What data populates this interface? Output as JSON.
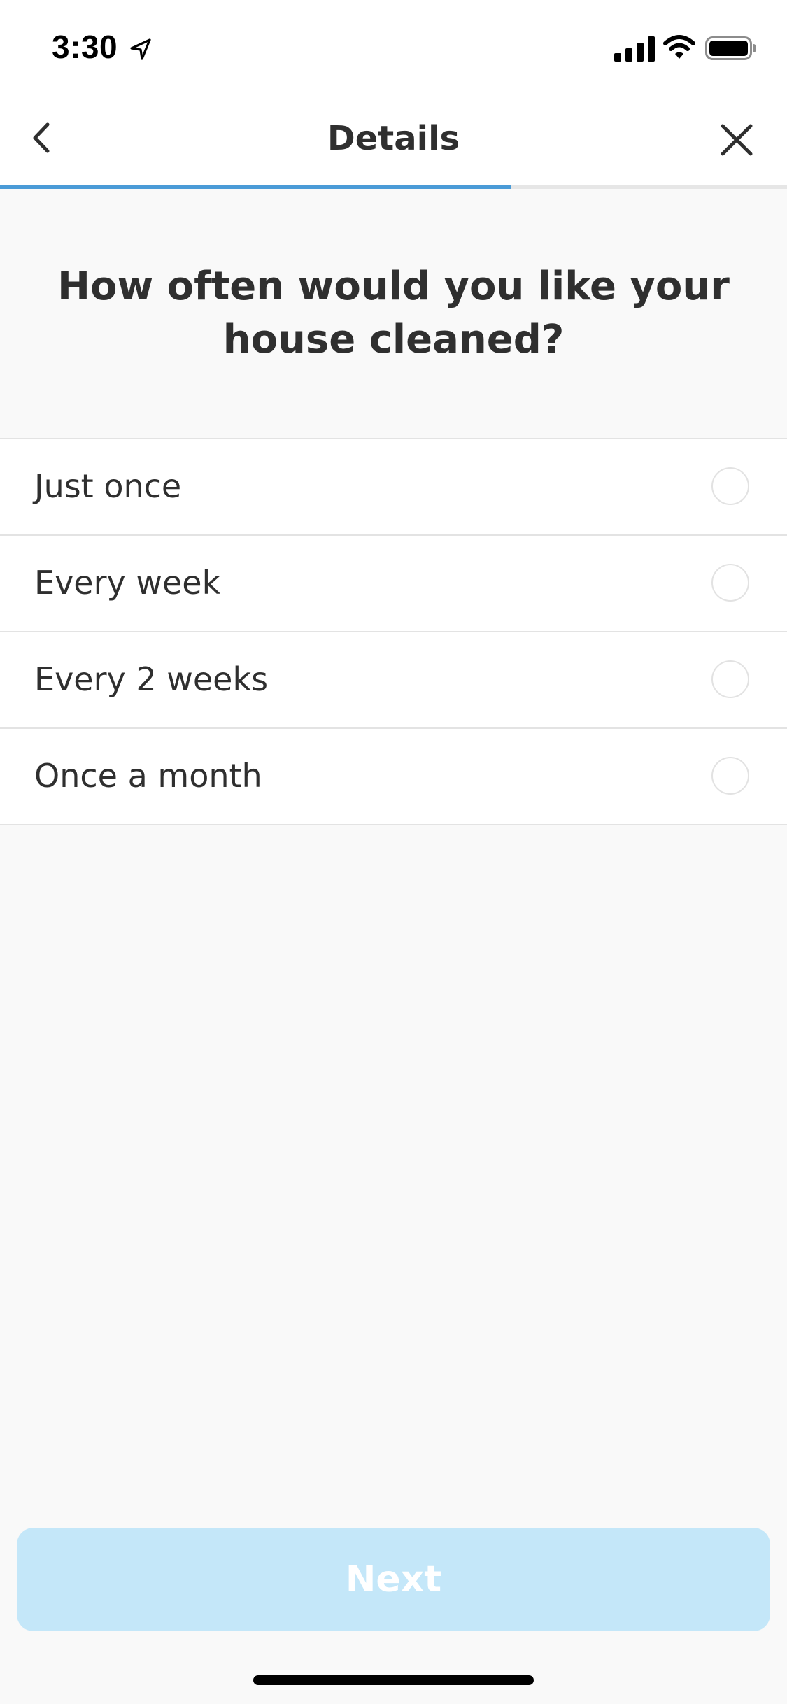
{
  "status_bar": {
    "time": "3:30",
    "icons": [
      "location-arrow-icon",
      "cellular-signal-icon",
      "wifi-icon",
      "battery-icon"
    ]
  },
  "nav": {
    "title": "Details",
    "back_icon": "chevron-left-icon",
    "close_icon": "close-icon",
    "progress_fraction": 0.65
  },
  "question": {
    "text": "How often would you like your house cleaned?"
  },
  "options": [
    {
      "label": "Just once",
      "selected": false
    },
    {
      "label": "Every week",
      "selected": false
    },
    {
      "label": "Every 2 weeks",
      "selected": false
    },
    {
      "label": "Once a month",
      "selected": false
    }
  ],
  "footer": {
    "next_label": "Next",
    "next_enabled": false
  },
  "colors": {
    "accent": "#4a9bd7",
    "next_disabled_bg": "#c4e7f9",
    "background": "#f9f9f9"
  }
}
